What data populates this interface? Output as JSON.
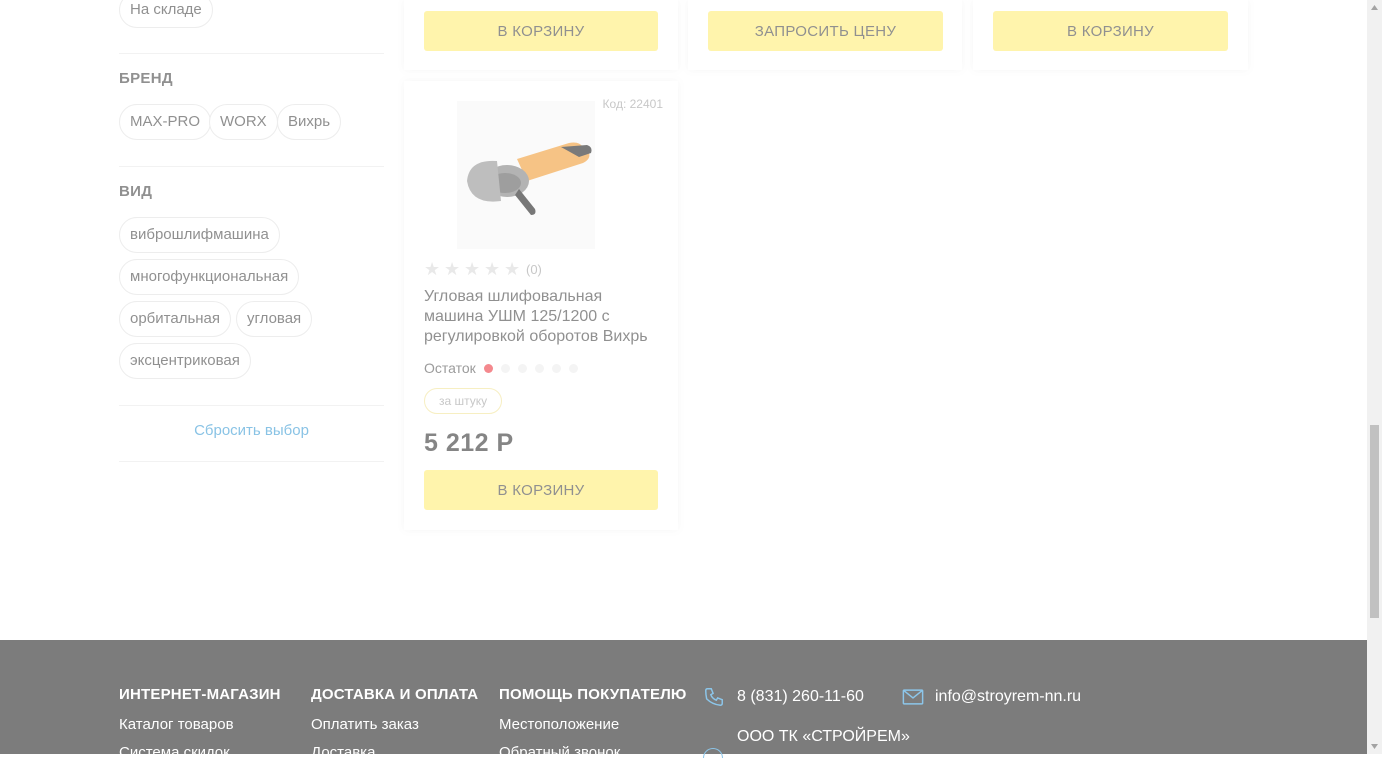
{
  "sidebar": {
    "availability_chip": "На складе",
    "brand": {
      "title": "БРЕНД",
      "chips": [
        "MAX-PRO",
        "WORX",
        "Вихрь"
      ]
    },
    "type": {
      "title": "ВИД",
      "chips": [
        "виброшлифмашина",
        "многофункциональная",
        "орбитальная",
        "угловая",
        "эксцентриковая"
      ]
    },
    "reset_label": "Сбросить выбор"
  },
  "top_cards": {
    "buttons": [
      "В КОРЗИНУ",
      "ЗАПРОСИТЬ ЦЕНУ",
      "В КОРЗИНУ"
    ]
  },
  "product": {
    "code": "Код: 22401",
    "image_icon": "angle-grinder-image",
    "rating_count": "(0)",
    "title": "Угловая шлифовальная машина УШМ 125/1200 с регулировкой оборотов Вихрь",
    "stock_label": "Остаток",
    "stock_level": 1,
    "stock_max": 6,
    "unit": "за штуку",
    "price": "5 212 Р",
    "button": "В КОРЗИНУ"
  },
  "footer": {
    "col1": {
      "title": "ИНТЕРНЕТ-МАГАЗИН",
      "links": [
        "Каталог товаров",
        "Система скидок"
      ]
    },
    "col2": {
      "title": "ДОСТАВКА И ОПЛАТА",
      "links": [
        "Оплатить заказ",
        "Доставка"
      ]
    },
    "col3": {
      "title": "ПОМОЩЬ ПОКУПАТЕЛЮ",
      "links": [
        "Местоположение",
        "Обратный звонок"
      ]
    },
    "phone": "8 (831) 260-11-60",
    "email": "info@stroyrem-nn.ru",
    "company": "ООО ТК «СТРОЙРЕМ»"
  },
  "colors": {
    "accent_yellow": "#ffee80",
    "link_blue": "#4aa3d8",
    "stock_red": "#ef4a52",
    "footer_bg": "#7c7c7c"
  }
}
